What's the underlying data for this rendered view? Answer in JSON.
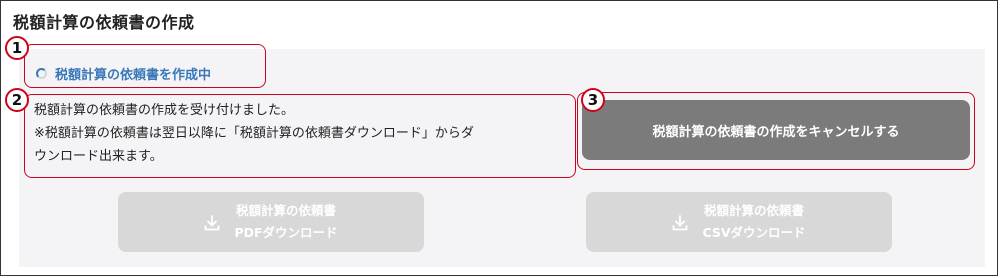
{
  "page": {
    "title": "税額計算の依頼書の作成"
  },
  "status": {
    "text": "税額計算の依頼書を作成中",
    "icon": "spinner-icon"
  },
  "message": {
    "line1": "税額計算の依頼書の作成を受け付けました。",
    "line2": "※税額計算の依頼書は翌日以降に「税額計算の依頼書ダウンロード」からダ",
    "line3": "ウンロード出来ます。"
  },
  "buttons": {
    "cancel_label": "税額計算の依頼書の作成をキャンセルする",
    "pdf_line1": "税額計算の依頼書",
    "pdf_line2": "PDFダウンロード",
    "csv_line1": "税額計算の依頼書",
    "csv_line2": "CSVダウンロード",
    "download_icon": "download-icon"
  },
  "annotations": {
    "badge1": "1",
    "badge2": "2",
    "badge3": "3"
  },
  "colors": {
    "accent": "#3a78b8",
    "annotation_red": "#d0021b",
    "cancel_bg": "#7b7b7b",
    "disabled_bg": "#d8d8d8"
  }
}
